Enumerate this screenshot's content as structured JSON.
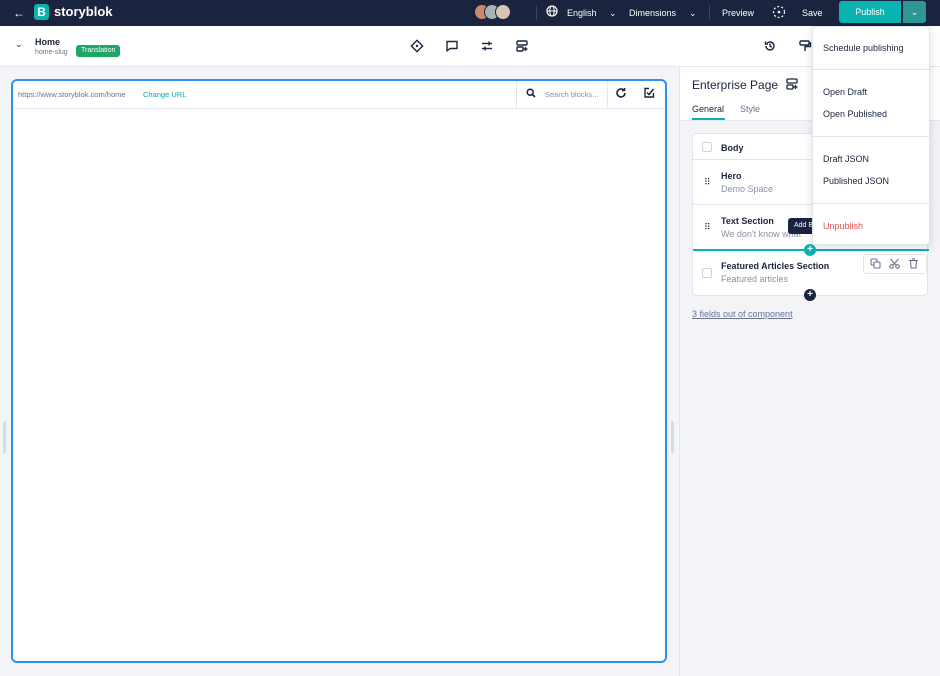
{
  "topbar": {
    "back_icon": "arrow-left-icon",
    "logo_letter": "B",
    "brand": "storyblok",
    "language": "English",
    "dimensions": "Dimensions",
    "preview": "Preview",
    "save": "Save",
    "publish": "Publish",
    "colors": {
      "bar": "#1b243f",
      "accent": "#09b3af"
    }
  },
  "story": {
    "title": "Home",
    "slug": "home-slug",
    "badge": "Translation"
  },
  "preview": {
    "url": "https://www.storyblok.com/home",
    "change_url": "Change URL",
    "search_placeholder": "Search blocks..."
  },
  "panel": {
    "title": "Enterprise Page",
    "tabs": [
      {
        "label": "General",
        "active": true
      },
      {
        "label": "Style",
        "active": false
      }
    ],
    "body_label": "Body",
    "blocks": [
      {
        "title": "Hero",
        "subtitle": "Demo Space"
      },
      {
        "title": "Text Section",
        "subtitle": "We don't know what"
      },
      {
        "title": "Featured Articles Section",
        "subtitle": "Featured articles"
      }
    ],
    "tooltip": "Add Block",
    "fields_link": "3 fields out of component"
  },
  "publish_menu": {
    "items": [
      {
        "label": "Schedule publishing"
      },
      {
        "label": "Open Draft"
      },
      {
        "label": "Open Published"
      },
      {
        "label": "Draft JSON"
      },
      {
        "label": "Published JSON"
      },
      {
        "label": "Unpublish",
        "danger": true
      }
    ]
  }
}
